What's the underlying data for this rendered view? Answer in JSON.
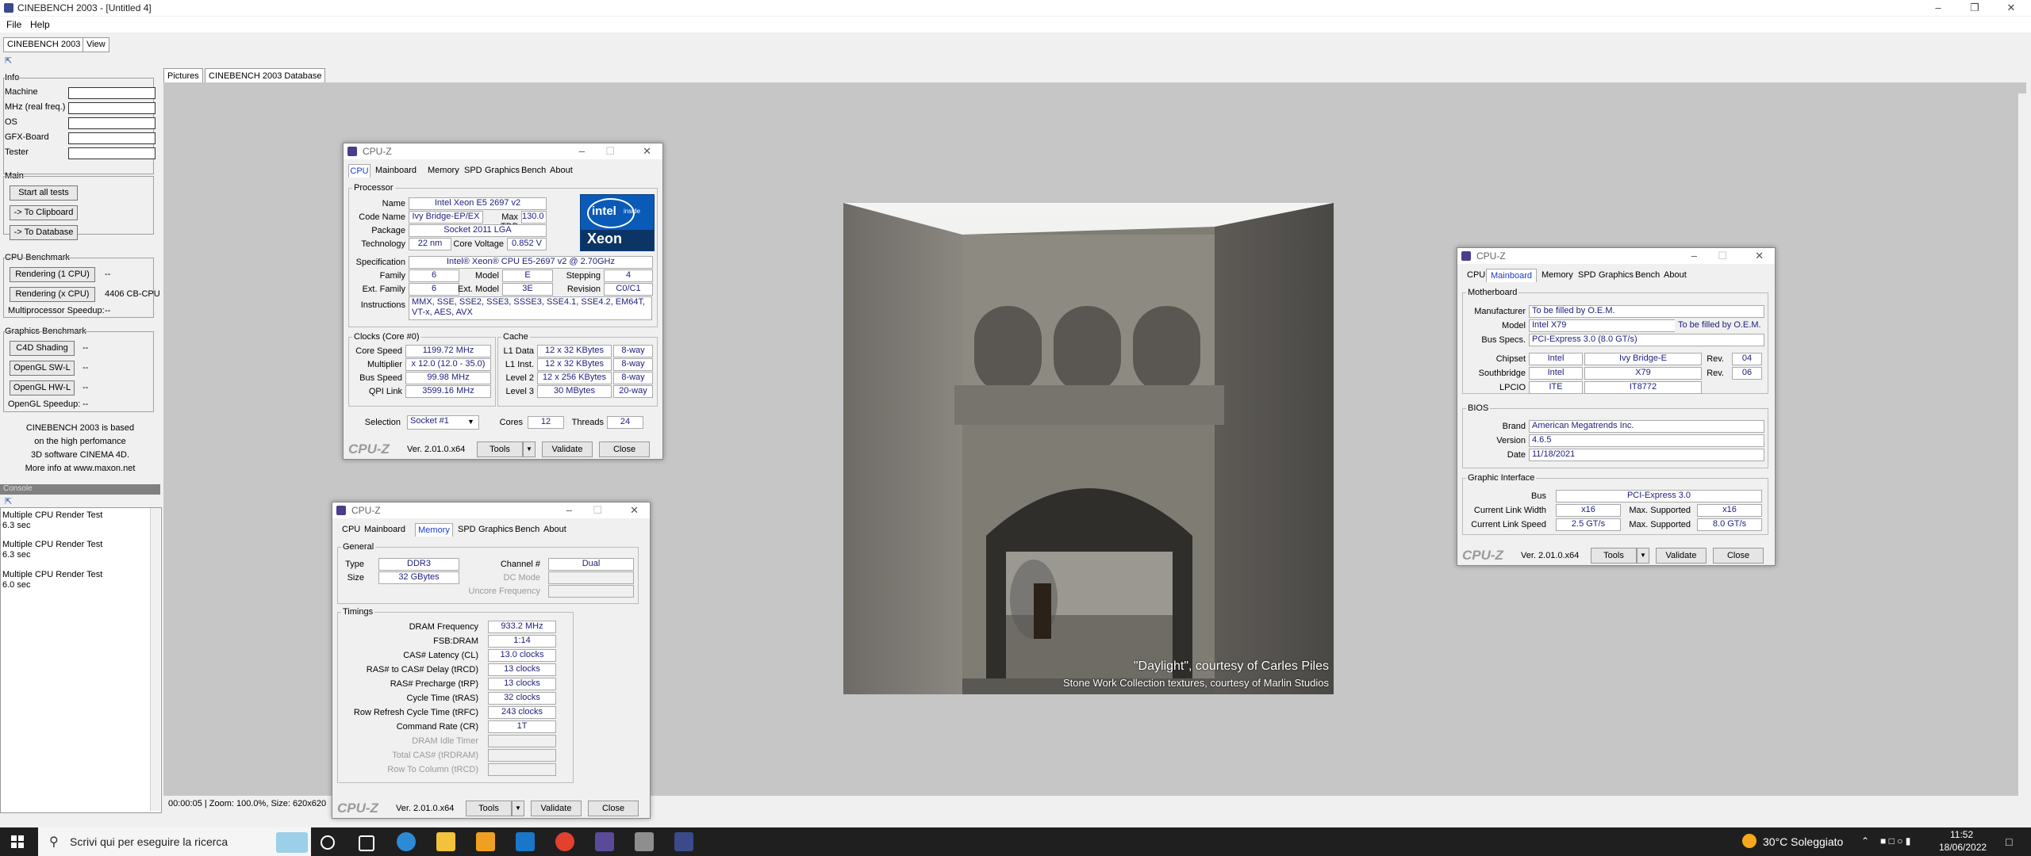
{
  "window": {
    "title": "CINEBENCH 2003 - [Untitled 4]"
  },
  "menu": [
    "File",
    "Help"
  ],
  "app_tabs": [
    "CINEBENCH 2003",
    "View"
  ],
  "info": {
    "title": "Info",
    "labels": [
      "Machine",
      "MHz (real freq.)",
      "OS",
      "GFX-Board",
      "Tester"
    ]
  },
  "main_group": {
    "title": "Main",
    "start_all": "Start all tests",
    "to_clipboard": "-> To Clipboard",
    "to_database": "-> To Database"
  },
  "cpu_bench": {
    "title": "CPU Benchmark",
    "rendering_1": "Rendering (1 CPU)",
    "rendering_1_result": "--",
    "rendering_x": "Rendering (x CPU)",
    "rendering_x_result": "4406 CB-CPU",
    "mp_speedup_label": "Multiprocessor Speedup:",
    "mp_speedup_value": "--"
  },
  "gfx_bench": {
    "title": "Graphics Benchmark",
    "c4d": "C4D Shading",
    "ogl_sw": "OpenGL SW-L",
    "ogl_hw": "OpenGL HW-L",
    "result": "--",
    "ogl_speedup_label": "OpenGL Speedup:",
    "ogl_speedup_value": "--"
  },
  "about": [
    "CINEBENCH 2003 is based",
    "on the high perfomance",
    "3D software CINEMA 4D.",
    "More info at www.maxon.net"
  ],
  "console": {
    "title": "Console",
    "lines": [
      "Multiple CPU Render Test",
      "6.3 sec",
      "Multiple CPU Render Test",
      "6.3 sec",
      "Multiple CPU Render Test",
      "6.0 sec"
    ]
  },
  "picture_tabs": [
    "Pictures",
    "CINEBENCH 2003 Database"
  ],
  "status_bar": "00:00:05 | Zoom: 100.0%, Size: 620x620",
  "render_caption": {
    "line1": "\"Daylight\", courtesy of Carles Piles",
    "line2": "Stone Work Collection textures, courtesy of Marlin Studios"
  },
  "cpuz_common": {
    "title": "CPU-Z",
    "tabs": [
      "CPU",
      "Mainboard",
      "Memory",
      "SPD",
      "Graphics",
      "Bench",
      "About"
    ],
    "brand": "CPU-Z",
    "version": "Ver. 2.01.0.x64",
    "tools": "Tools",
    "validate": "Validate",
    "close": "Close"
  },
  "cpuz_cpu": {
    "processor_title": "Processor",
    "name_label": "Name",
    "name": "Intel Xeon E5 2697 v2",
    "codename_label": "Code Name",
    "codename": "Ivy Bridge-EP/EX",
    "maxtdp_label": "Max TDP",
    "maxtdp": "130.0 W",
    "package_label": "Package",
    "package": "Socket 2011 LGA",
    "tech_label": "Technology",
    "tech": "22 nm",
    "voltage_label": "Core Voltage",
    "voltage": "0.852 V",
    "spec_label": "Specification",
    "spec": "Intel® Xeon® CPU E5-2697 v2 @ 2.70GHz",
    "family_label": "Family",
    "family": "6",
    "model_label": "Model",
    "model": "E",
    "stepping_label": "Stepping",
    "stepping": "4",
    "extfamily_label": "Ext. Family",
    "extfamily": "6",
    "extmodel_label": "Ext. Model",
    "extmodel": "3E",
    "revision_label": "Revision",
    "revision": "C0/C1",
    "instr_label": "Instructions",
    "instr": "MMX, SSE, SSE2, SSE3, SSSE3, SSE4.1, SSE4.2, EM64T, VT-x, AES, AVX",
    "clocks_title": "Clocks (Core #0)",
    "corespeed_label": "Core Speed",
    "corespeed": "1199.72 MHz",
    "multiplier_label": "Multiplier",
    "multiplier": "x 12.0 (12.0 - 35.0)",
    "busspeed_label": "Bus Speed",
    "busspeed": "99.98 MHz",
    "qpi_label": "QPI Link",
    "qpi": "3599.16 MHz",
    "cache_title": "Cache",
    "l1d_label": "L1 Data",
    "l1d": "12 x 32 KBytes",
    "l1d_way": "8-way",
    "l1i_label": "L1 Inst.",
    "l1i": "12 x 32 KBytes",
    "l1i_way": "8-way",
    "l2_label": "Level 2",
    "l2": "12 x 256 KBytes",
    "l2_way": "8-way",
    "l3_label": "Level 3",
    "l3": "30 MBytes",
    "l3_way": "20-way",
    "selection_label": "Selection",
    "selection": "Socket #1",
    "cores_label": "Cores",
    "cores": "12",
    "threads_label": "Threads",
    "threads": "24",
    "logo_intel": "intel",
    "logo_inside": "inside",
    "logo_xeon": "Xeon"
  },
  "cpuz_memory": {
    "general_title": "General",
    "type_label": "Type",
    "type": "DDR3",
    "size_label": "Size",
    "size": "32 GBytes",
    "channel_label": "Channel #",
    "channel": "Dual",
    "dcmode_label": "DC Mode",
    "uncore_label": "Uncore Frequency",
    "timings_title": "Timings",
    "rows": [
      {
        "label": "DRAM Frequency",
        "value": "933.2 MHz"
      },
      {
        "label": "FSB:DRAM",
        "value": "1:14"
      },
      {
        "label": "CAS# Latency (CL)",
        "value": "13.0 clocks"
      },
      {
        "label": "RAS# to CAS# Delay (tRCD)",
        "value": "13 clocks"
      },
      {
        "label": "RAS# Precharge (tRP)",
        "value": "13 clocks"
      },
      {
        "label": "Cycle Time (tRAS)",
        "value": "32 clocks"
      },
      {
        "label": "Row Refresh Cycle Time (tRFC)",
        "value": "243 clocks"
      },
      {
        "label": "Command Rate (CR)",
        "value": "1T"
      }
    ],
    "disabled_rows": [
      "DRAM Idle Timer",
      "Total CAS# (tRDRAM)",
      "Row To Column (tRCD)"
    ]
  },
  "cpuz_mainboard": {
    "mb_title": "Motherboard",
    "manufacturer_label": "Manufacturer",
    "manufacturer": "To be filled by O.E.M.",
    "model_label": "Model",
    "model": "Intel X79",
    "model_rev": "To be filled by O.E.M.",
    "busspecs_label": "Bus Specs.",
    "busspecs": "PCI-Express 3.0 (8.0 GT/s)",
    "chipset_label": "Chipset",
    "chipset_vendor": "Intel",
    "chipset_name": "Ivy Bridge-E",
    "chipset_rev_label": "Rev.",
    "chipset_rev": "04",
    "south_label": "Southbridge",
    "south_vendor": "Intel",
    "south_name": "X79",
    "south_rev_label": "Rev.",
    "south_rev": "06",
    "lpcio_label": "LPCIO",
    "lpcio_vendor": "ITE",
    "lpcio_name": "IT8772",
    "bios_title": "BIOS",
    "brand_label": "Brand",
    "brand": "American Megatrends Inc.",
    "version_label": "Version",
    "version": "4.6.5",
    "date_label": "Date",
    "date": "11/18/2021",
    "gi_title": "Graphic Interface",
    "bus_label": "Bus",
    "bus": "PCI-Express 3.0",
    "clw_label": "Current Link Width",
    "clw": "x16",
    "msw_label": "Max. Supported",
    "msw": "x16",
    "cls_label": "Current Link Speed",
    "cls": "2.5 GT/s",
    "mss_label": "Max. Supported",
    "mss": "8.0 GT/s"
  },
  "taskbar": {
    "search_placeholder": "Scrivi qui per eseguire la ricerca",
    "weather": "30°C Soleggiato",
    "time": "11:52",
    "date": "18/06/2022"
  }
}
